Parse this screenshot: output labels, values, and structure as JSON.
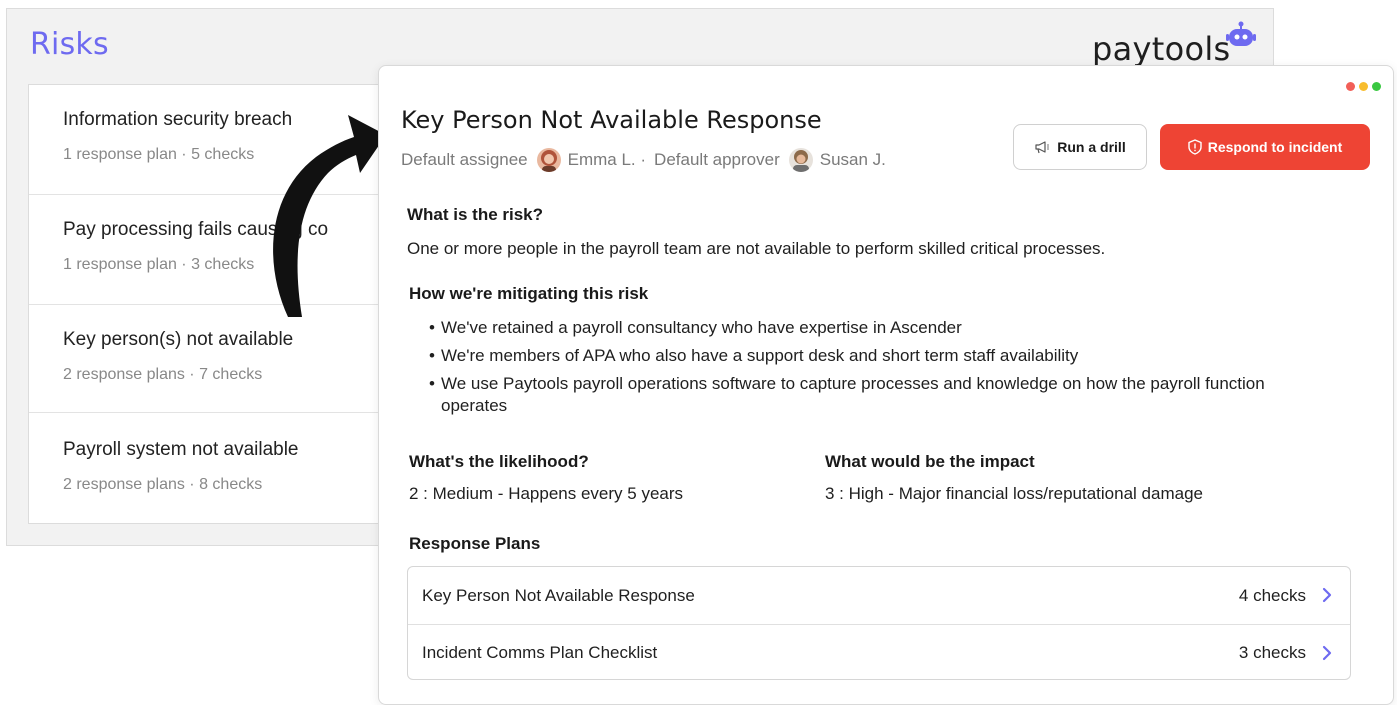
{
  "background": {
    "title": "Risks",
    "logo_text": "paytools",
    "risks": [
      {
        "name": "Information security breach",
        "meta": "1 response plan  ·  5 checks"
      },
      {
        "name": "Pay processing fails causing co",
        "meta": "1 response plan  ·  3 checks"
      },
      {
        "name": "Key person(s) not available",
        "meta": "2 response plans  ·  7 checks"
      },
      {
        "name": "Payroll system not available",
        "meta": "2 response plans  ·  8 checks"
      }
    ]
  },
  "modal": {
    "title": "Key Person Not Available Response",
    "assignee_label": "Default assignee",
    "assignee_name": "Emma L. ·",
    "approver_label": "Default approver",
    "approver_name": "Susan J.",
    "drill_label": "Run a drill",
    "respond_label": "Respond to incident",
    "risk_heading": "What is the risk?",
    "risk_text": "One or more people in the payroll team are not available to perform skilled critical processes.",
    "mitigation_heading": "How we're mitigating this risk",
    "mitigations": [
      "We've retained a payroll consultancy who have expertise in Ascender",
      "We're members of APA who also have a support desk and short term staff availability",
      "We use Paytools payroll operations software to capture processes and knowledge on how the payroll function operates"
    ],
    "likelihood_heading": "What's the likelihood?",
    "likelihood_text": "2 : Medium - Happens every 5 years",
    "impact_heading": "What would be the impact",
    "impact_text": "3 : High - Major financial loss/reputational damage",
    "plans_heading": "Response Plans",
    "plans": [
      {
        "name": "Key Person Not Available Response",
        "checks": "4 checks"
      },
      {
        "name": "Incident Comms Plan Checklist",
        "checks": "3 checks"
      }
    ]
  },
  "colors": {
    "accent": "#6e6af0",
    "danger": "#ee4434",
    "dot_red": "#f25f58",
    "dot_yellow": "#f8bd2e",
    "dot_green": "#3ac841"
  }
}
